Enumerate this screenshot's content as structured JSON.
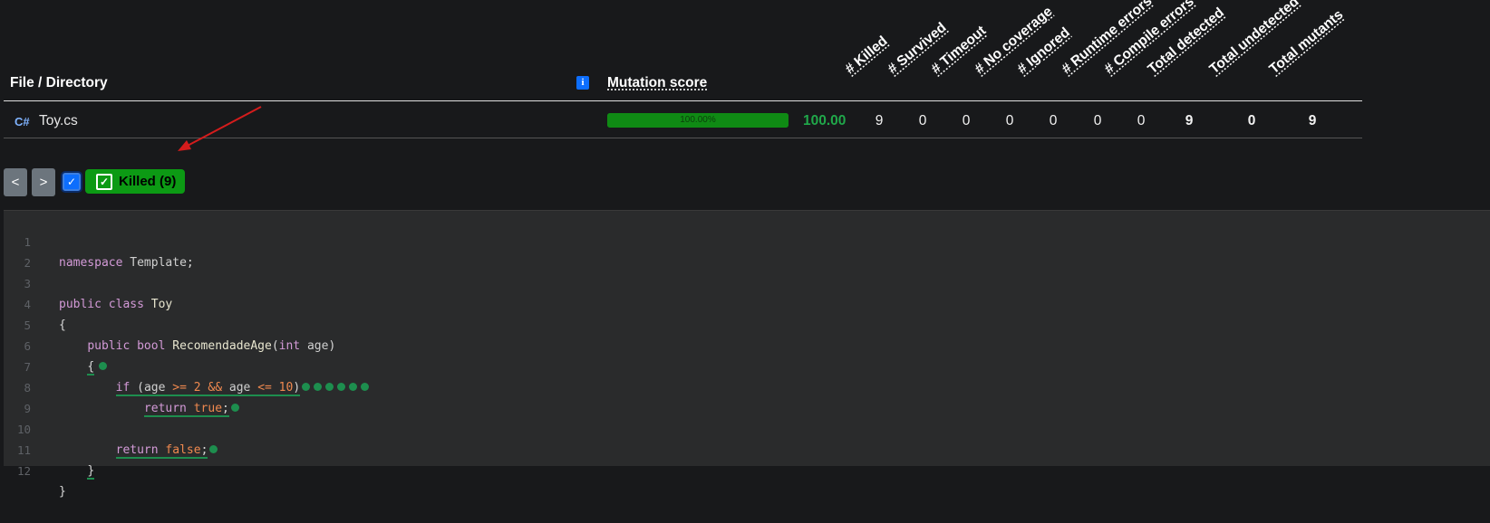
{
  "table": {
    "header_file": "File / Directory",
    "header_info_icon": "i",
    "header_mutation_score": "Mutation score",
    "columns": [
      "# Killed",
      "# Survived",
      "# Timeout",
      "# No coverage",
      "# Ignored",
      "# Runtime errors",
      "# Compile errors",
      "Total detected",
      "Total undetected",
      "Total mutants"
    ],
    "row": {
      "file_icon": "csharp-icon",
      "file_name": "Toy.cs",
      "progress_label": "100.00%",
      "progress_fraction": 1.0,
      "score": "100.00",
      "values": [
        "9",
        "0",
        "0",
        "0",
        "0",
        "0",
        "0",
        "9",
        "0",
        "9"
      ]
    }
  },
  "filter": {
    "prev_label": "<",
    "next_label": ">",
    "killed_label": "Killed (9)"
  },
  "code": {
    "lines": [
      {
        "n": "1"
      },
      {
        "n": "2"
      },
      {
        "n": "3"
      },
      {
        "n": "4"
      },
      {
        "n": "5"
      },
      {
        "n": "6"
      },
      {
        "n": "7"
      },
      {
        "n": "8"
      },
      {
        "n": "9"
      },
      {
        "n": "10"
      },
      {
        "n": "11"
      },
      {
        "n": "12"
      }
    ],
    "tokens": {
      "namespace": "namespace",
      "template": "Template",
      "semi": ";",
      "public": "public",
      "class": "class",
      "toy": "Toy",
      "open_brace": "{",
      "close_brace": "}",
      "bool": "bool",
      "method": "RecomendadeAge",
      "lparen": "(",
      "int": "int",
      "age": "age",
      "rparen": ")",
      "if": "if",
      "ge": ">=",
      "two": "2",
      "and": "&&",
      "le": "<=",
      "ten": "10",
      "return": "return",
      "true": "true",
      "false": "false"
    }
  },
  "colors": {
    "accent_green": "#0c9a14",
    "score_green": "#20a84a",
    "mutant_dot": "#1d8e4e",
    "arrow_red": "#d41c1c"
  }
}
